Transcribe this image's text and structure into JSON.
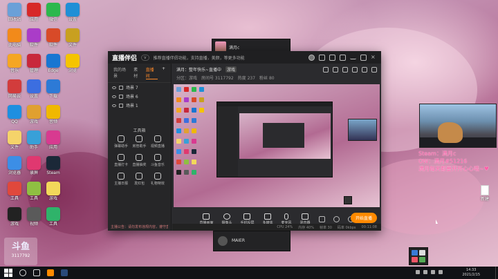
{
  "desktop": {
    "icons": [
      {
        "label": "回收站",
        "color": "#6aa0d8"
      },
      {
        "label": "此电脑",
        "color": "#f28a1a"
      },
      {
        "label": "音乐",
        "color": "#f5a623"
      },
      {
        "label": "网易云",
        "color": "#d23c3c"
      },
      {
        "label": "QQ",
        "color": "#1e8fe0"
      },
      {
        "label": "文件",
        "color": "#f5d36a"
      },
      {
        "label": "浏览器",
        "color": "#3c8ee6"
      },
      {
        "label": "工具",
        "color": "#e0483c"
      },
      {
        "label": "游戏",
        "color": "#222"
      },
      {
        "label": "应用",
        "color": "#d72828"
      },
      {
        "label": "软件",
        "color": "#aa3cc8"
      },
      {
        "label": "管理",
        "color": "#c8283c"
      },
      {
        "label": "设置",
        "color": "#3c6ee0"
      },
      {
        "label": "游戏",
        "color": "#e0a030"
      },
      {
        "label": "助手",
        "color": "#38a0d8"
      },
      {
        "label": "录屏",
        "color": "#e03870"
      },
      {
        "label": "工具",
        "color": "#8fbf42"
      },
      {
        "label": "视频",
        "color": "#5a5a5a"
      },
      {
        "label": "微信",
        "color": "#2bb84c"
      },
      {
        "label": "软件",
        "color": "#d84a28"
      },
      {
        "label": "Edge",
        "color": "#1976d2"
      },
      {
        "label": "下载",
        "color": "#2d7ad6"
      },
      {
        "label": "音频",
        "color": "#f0b800"
      },
      {
        "label": "应用",
        "color": "#d83a90"
      },
      {
        "label": "Steam",
        "color": "#1b2838"
      },
      {
        "label": "游戏",
        "color": "#f2d85a"
      },
      {
        "label": "工具",
        "color": "#2fb36a"
      },
      {
        "label": "设置",
        "color": "#1f8fd6"
      },
      {
        "label": "文件",
        "color": "#c8a020"
      },
      {
        "label": "浏览",
        "color": "#f5c400"
      }
    ],
    "watermark": {
      "logo": "斗鱼",
      "room_id": "3117792"
    },
    "new_file_label": "新建"
  },
  "app": {
    "name": "直播伴侣",
    "version": "v",
    "notice": "推荐直播伴侣功能，支持直播，美颜，等更多功能",
    "side_tabs": [
      "我的场景",
      "素材",
      "直播间"
    ],
    "scenes": [
      "场景 7",
      "场景 6",
      "场景 1"
    ],
    "tools_title": "工具箱",
    "tools": [
      "弹幕助手",
      "房管助手",
      "视频直播",
      "直播打卡",
      "直播抽奖",
      "斗鱼音乐",
      "主播日报",
      "发红包",
      "礼物特效"
    ],
    "side_footer": "主播公告：请勿发布违规内容，遵守直播规范",
    "room": {
      "title": "满月：整年快乐~直播中",
      "tag": "游戏",
      "meta": [
        "分区：游戏",
        "房间号 3117792",
        "热度 237",
        "粉丝 80"
      ]
    },
    "controls": [
      "直播画面",
      "摄像头",
      "手机投屏",
      "多媒体",
      "麦克风",
      "混音器"
    ],
    "go_live": "开始直播",
    "status": [
      "CPU 24%",
      "内存 40%",
      "帧率 30",
      "码率 0kbps",
      "00:11:08"
    ]
  },
  "cam_overlay": {
    "line1": "Steam：满月c",
    "line2": "OW：满月#51216",
    "line3": "满月每天都要开开心心哦~♥"
  },
  "popups": {
    "top_name": "满月c",
    "bottom_name": "MAIER"
  },
  "taskbar": {
    "time": "14:33",
    "date": "2021/2/15"
  }
}
